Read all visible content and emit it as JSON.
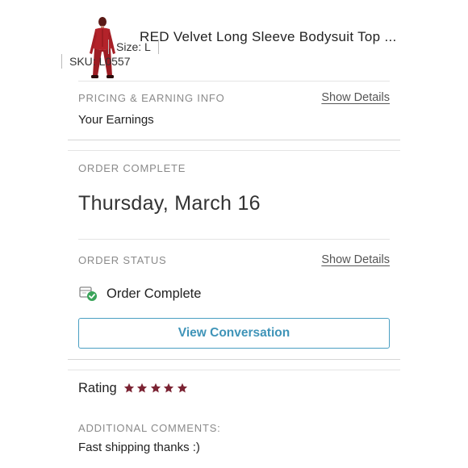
{
  "product": {
    "title": "RED Velvet Long Sleeve Bodysuit Top ...",
    "size": "Size: L",
    "sku": "SKU: L0557",
    "image_icon": "red-bodysuit-thumbnail"
  },
  "pricing": {
    "label": "PRICING & EARNING INFO",
    "show_details": "Show Details",
    "earnings_label": "Your Earnings"
  },
  "order_complete": {
    "label": "ORDER COMPLETE",
    "date": "Thursday, March 16"
  },
  "order_status": {
    "label": "ORDER STATUS",
    "show_details": "Show Details",
    "status_text": "Order Complete",
    "status_icon": "package-check-icon",
    "button_label": "View Conversation"
  },
  "rating": {
    "label": "Rating",
    "stars": 5,
    "max_stars": 5,
    "star_color": "#7b2333"
  },
  "comments": {
    "label": "ADDITIONAL COMMENTS:",
    "text": "Fast shipping thanks :)"
  },
  "colors": {
    "accent": "#3f94b8",
    "label_gray": "#8a8a8a",
    "divider": "#e4e4e4"
  }
}
